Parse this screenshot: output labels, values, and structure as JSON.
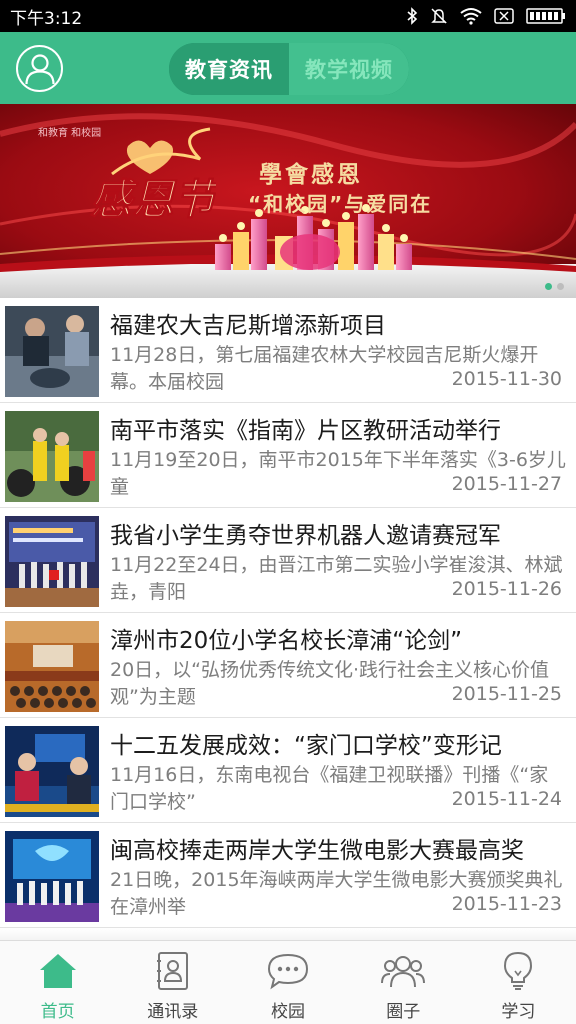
{
  "status_bar": {
    "time": "下午3:12",
    "icons": [
      "bluetooth-icon",
      "mute-icon",
      "wifi-icon",
      "no-sim-icon",
      "battery-icon"
    ]
  },
  "header": {
    "avatar_icon": "user-avatar-icon",
    "tabs": [
      {
        "label": "教育资讯",
        "active": true
      },
      {
        "label": "教学视频",
        "active": false
      }
    ],
    "accent_color": "#3dbb8a"
  },
  "banner": {
    "brand": "和教育 和校园",
    "festival": "感恩节",
    "slogan_line1": "學會感恩",
    "slogan_line2": "“和校园”与爱同在",
    "dots": 2,
    "active_dot": 0
  },
  "news": [
    {
      "title": "福建农大吉尼斯增添新项目",
      "summary": "11月28日，第七届福建农林大学校园吉尼斯火爆开幕。本届校园",
      "date": "2015-11-30",
      "thumb": "workshop"
    },
    {
      "title": "南平市落实《指南》片区教研活动举行",
      "summary": "11月19至20日，南平市2015年下半年落实《3-6岁儿童",
      "date": "2015-11-27",
      "thumb": "kids"
    },
    {
      "title": "我省小学生勇夺世界机器人邀请赛冠军",
      "summary": "11月22至24日，由晋江市第二实验小学崔浚淇、林斌垚，青阳",
      "date": "2015-11-26",
      "thumb": "stage"
    },
    {
      "title": "漳州市20位小学名校长漳浦“论剑”",
      "summary": "20日，以“弘扬优秀传统文化·践行社会主义核心价值观”为主题",
      "date": "2015-11-25",
      "thumb": "hall"
    },
    {
      "title": "十二五发展成效：“家门口学校”变形记",
      "summary": "11月16日，东南电视台《福建卫视联播》刊播《“家门口学校”",
      "date": "2015-11-24",
      "thumb": "tv"
    },
    {
      "title": "闽高校捧走两岸大学生微电影大赛最高奖",
      "summary": "21日晚，2015年海峡两岸大学生微电影大赛颁奖典礼在漳州举",
      "date": "2015-11-23",
      "thumb": "award"
    }
  ],
  "tab_bar": [
    {
      "label": "首页",
      "icon": "home-icon",
      "active": true
    },
    {
      "label": "通讯录",
      "icon": "contacts-icon",
      "active": false
    },
    {
      "label": "校园",
      "icon": "chat-bubble-icon",
      "active": false
    },
    {
      "label": "圈子",
      "icon": "group-icon",
      "active": false
    },
    {
      "label": "学习",
      "icon": "lightbulb-icon",
      "active": false
    }
  ]
}
